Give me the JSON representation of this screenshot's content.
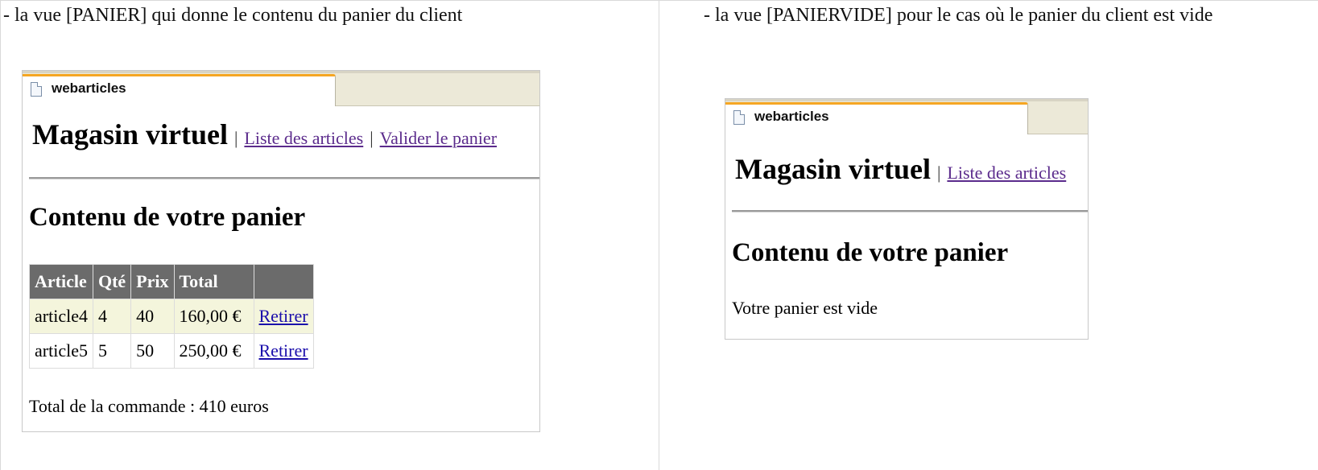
{
  "captions": {
    "left": "- la vue [PANIER] qui donne le contenu du panier du client",
    "right": "- la vue [PANIERVIDE] pour le cas où le panier du client est vide"
  },
  "panier": {
    "tab_title": "webarticles",
    "site_title": "Magasin virtuel",
    "separator": "|",
    "nav": [
      {
        "label": "Liste des articles"
      },
      {
        "label": "Valider le panier"
      }
    ],
    "section_title": "Contenu de votre panier",
    "table": {
      "headers": [
        "Article",
        "Qté",
        "Prix",
        "Total",
        ""
      ],
      "rows": [
        {
          "article": "article4",
          "qte": "4",
          "prix": "40",
          "total": "160,00 €",
          "action": "Retirer"
        },
        {
          "article": "article5",
          "qte": "5",
          "prix": "50",
          "total": "250,00 €",
          "action": "Retirer"
        }
      ]
    },
    "order_total": "Total de la commande : 410 euros"
  },
  "panier_vide": {
    "tab_title": "webarticles",
    "site_title": "Magasin virtuel",
    "separator": "|",
    "nav": [
      {
        "label": "Liste des articles"
      }
    ],
    "section_title": "Contenu de votre panier",
    "empty_message": "Votre panier est vide"
  },
  "colors": {
    "tab_accent": "#f5a623",
    "table_header": "#6b6b6b",
    "row_highlight": "#f4f5dc",
    "visited_link": "#5b2b8c",
    "link": "#1a0dab"
  }
}
